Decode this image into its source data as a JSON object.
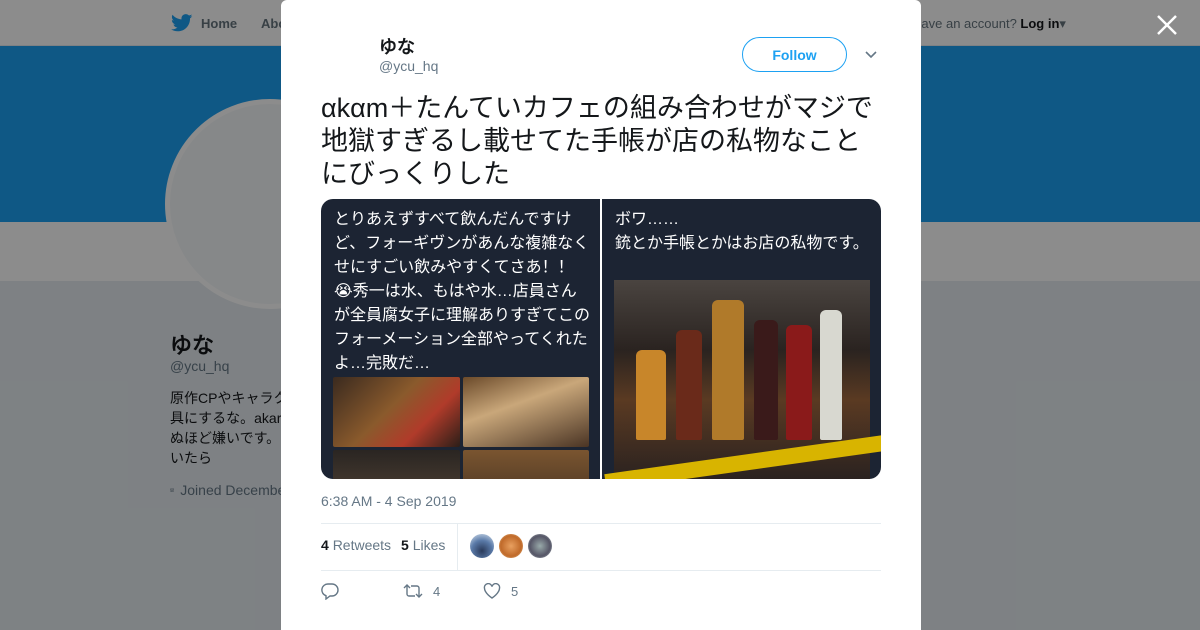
{
  "nav": {
    "home_label": "Home",
    "about_label": "About",
    "account_prompt": "Have an account?",
    "login_label": "Log in"
  },
  "profile": {
    "name": "ゆな",
    "handle": "@ycu_hq",
    "bio_line1": "原作CPやキャラク",
    "bio_line2": "具にするな。akar",
    "bio_line3": "ぬほど嫌いです。",
    "bio_line4": "いたら",
    "joined": "Joined December"
  },
  "tweet": {
    "author_name": "ゆな",
    "author_handle": "@ycu_hq",
    "follow_label": "Follow",
    "text": "αkαm＋たんていカフェの組み合わせがマジで地獄すぎるし載せてた手帳が店の私物なことにびっくりした",
    "image_left_text": "とりあえずすべて飲んだんですけど、フォーギヴンがあんな複雑なくせにすごい飲みやすくてさあ！！😭秀一は水、もはや水…店員さんが全員腐女子に理解ありすぎてこのフォーメーション全部やってくれたよ…完敗だ…",
    "image_right_text_line1": "ボワ……",
    "image_right_text_line2": "銃とか手帳とかはお店の私物です。",
    "timestamp": "6:38 AM - 4 Sep 2019",
    "retweets_count": "4",
    "retweets_label": "Retweets",
    "likes_count": "5",
    "likes_label": "Likes",
    "action_retweet_count": "4",
    "action_like_count": "5"
  },
  "colors": {
    "brand": "#1da1f2",
    "screenshot_bg": "#1c2433"
  }
}
